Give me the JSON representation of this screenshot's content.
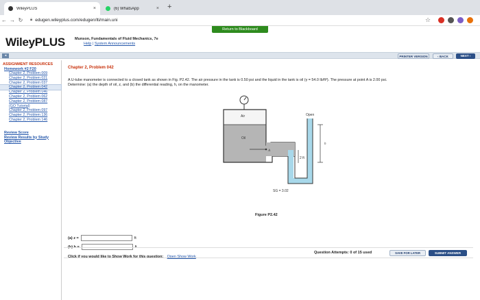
{
  "browser": {
    "tabs": [
      {
        "title": "WileyPLUS",
        "close": "×"
      },
      {
        "title": "(6) WhatsApp",
        "close": "×"
      }
    ],
    "new_tab": "+",
    "url": "edugen.wileyplus.com/edugen/lti/main.uni",
    "ext_colors": [
      "#d93025",
      "#555555",
      "#7b5ec6",
      "#e8710a"
    ]
  },
  "header": {
    "return_button": "Return to Blackboard",
    "logo": "WileyPLUS",
    "book_title": "Munson, Fundamentals of Fluid Mechanics, 7e",
    "help_link": "Help",
    "separator": " | ",
    "announcements_link": "System Announcements"
  },
  "toolbar": {
    "collapse_icon": "◂",
    "print": "PRINTER VERSION",
    "back": "‹ BACK",
    "next": "NEXT ›"
  },
  "sidebar": {
    "heading": "ASSIGNMENT RESOURCES",
    "assignment": "Homework #2 F20",
    "items": [
      "Chapter 2, Problem 009",
      "Chapter 2, Problem 021",
      "Chapter 2, Problem 037",
      "Chapter 2, Problem 042",
      "Chapter 2, Problem 046",
      "Chapter 2, Problem 062",
      "Chapter 2, Problem 087",
      "(GO Tutorial)",
      "Chapter 2, Problem 097",
      "Chapter 2, Problem 136",
      "Chapter 2, Problem 146"
    ],
    "review_score": "Review Score",
    "review_results_1": "Review Results by Study",
    "review_results_2": "Objective"
  },
  "problem": {
    "title": "Chapter 2, Problem 042",
    "text_line1": "A U-tube manometer is connected to a closed tank as shown in Fig. P2.42. The air pressure in the tank is 0.50 psi and the liquid in the tank is oil (γ = 54.0 lb/ft³). The pressure at point A is 2.00 psi.",
    "text_line2": "Determine: (a) the depth of oil, z, and (b) the differential reading, h, on the manometer."
  },
  "figure": {
    "label_air": "Air",
    "label_oil": "Oil",
    "label_open": "Open",
    "label_z": "z",
    "label_A": "A",
    "label_h": "h",
    "label_2ft": "2 ft",
    "label_sg": "SG = 3.02",
    "caption": "Figure P2.42"
  },
  "answers": {
    "a_label": "(a) z =",
    "a_unit": "ft",
    "b_label": "(b) h =",
    "b_unit": "ft",
    "show_work_prompt": "Click if you would like to Show Work for this question:",
    "show_work_link": "Open Show Work"
  },
  "footer": {
    "attempts": "Question Attempts: 0 of 15 used",
    "save": "SAVE FOR LATER",
    "submit": "SUBMIT ANSWER"
  }
}
